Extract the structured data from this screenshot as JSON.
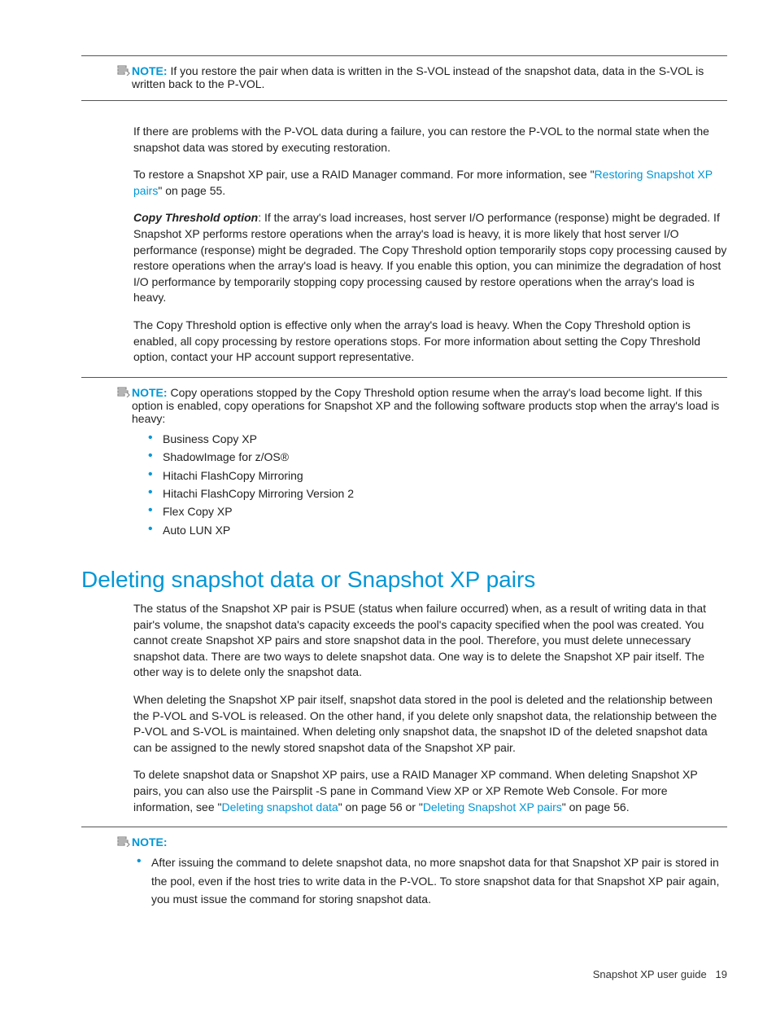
{
  "note1": {
    "label": "NOTE:",
    "text": "If you restore the pair when data is written in the S-VOL instead of the snapshot data, data in the S-VOL is written back to the P-VOL."
  },
  "para1": "If there are problems with the P-VOL data during a failure, you can restore the P-VOL to the normal state when the snapshot data was stored by executing restoration.",
  "para2_pre": "To restore a Snapshot XP pair, use a RAID Manager command. For more information, see \"",
  "para2_link": "Restoring Snapshot XP pairs",
  "para2_post": "\" on page 55.",
  "para3_label": "Copy Threshold option",
  "para3_text": ": If the array's load increases, host server I/O performance (response) might be degraded. If Snapshot XP performs restore operations when the array's load is heavy, it is more likely that host server I/O performance (response) might be degraded. The Copy Threshold option temporarily stops copy processing caused by restore operations when the array's load is heavy. If you enable this option, you can minimize the degradation of host I/O performance by temporarily stopping copy processing caused by restore operations when the array's load is heavy.",
  "para4": "The Copy Threshold option is effective only when the array's load is heavy. When the Copy Threshold option is enabled, all copy processing by restore operations stops. For more information about setting the Copy Threshold option, contact your HP account support representative.",
  "note2": {
    "label": "NOTE:",
    "text": "Copy operations stopped by the Copy Threshold option resume when the array's load become light. If this option is enabled, copy operations for Snapshot XP and the following software products stop when the array's load is heavy:"
  },
  "list2": [
    "Business Copy XP",
    "ShadowImage for z/OS®",
    "Hitachi FlashCopy Mirroring",
    "Hitachi FlashCopy Mirroring Version 2",
    "Flex Copy XP",
    "Auto LUN XP"
  ],
  "heading": "Deleting snapshot data or Snapshot XP pairs",
  "para5": "The status of the Snapshot XP pair is PSUE (status when failure occurred) when, as a result of writing data in that pair's volume, the snapshot data's capacity exceeds the pool's capacity specified when the pool was created. You cannot create Snapshot XP pairs and store snapshot data in the pool. Therefore, you must delete unnecessary snapshot data. There are two ways to delete snapshot data. One way is to delete the Snapshot XP pair itself. The other way is to delete only the snapshot data.",
  "para6": "When deleting the Snapshot XP pair itself, snapshot data stored in the pool is deleted and the relationship between the P-VOL and S-VOL is released. On the other hand, if you delete only snapshot data, the relationship between the P-VOL and S-VOL is maintained. When deleting only snapshot data, the snapshot ID of the deleted snapshot data can be assigned to the newly stored snapshot data of the Snapshot XP pair.",
  "para7_pre": "To delete snapshot data or Snapshot XP pairs, use a RAID Manager XP command. When deleting Snapshot XP pairs, you can also use the Pairsplit -S pane in Command View XP or XP Remote Web Console. For more information, see \"",
  "para7_link1": "Deleting snapshot data",
  "para7_mid": "\" on page 56 or \"",
  "para7_link2": "Deleting Snapshot XP pairs",
  "para7_post": "\" on page 56.",
  "note3": {
    "label": "NOTE:",
    "bullet": "After issuing the command to delete snapshot data, no more snapshot data for that Snapshot XP pair is stored in the pool, even if the host tries to write data in the P-VOL. To store snapshot data for that Snapshot XP pair again, you must issue the command for storing snapshot data."
  },
  "footer": {
    "title": "Snapshot XP user guide",
    "page": "19"
  }
}
